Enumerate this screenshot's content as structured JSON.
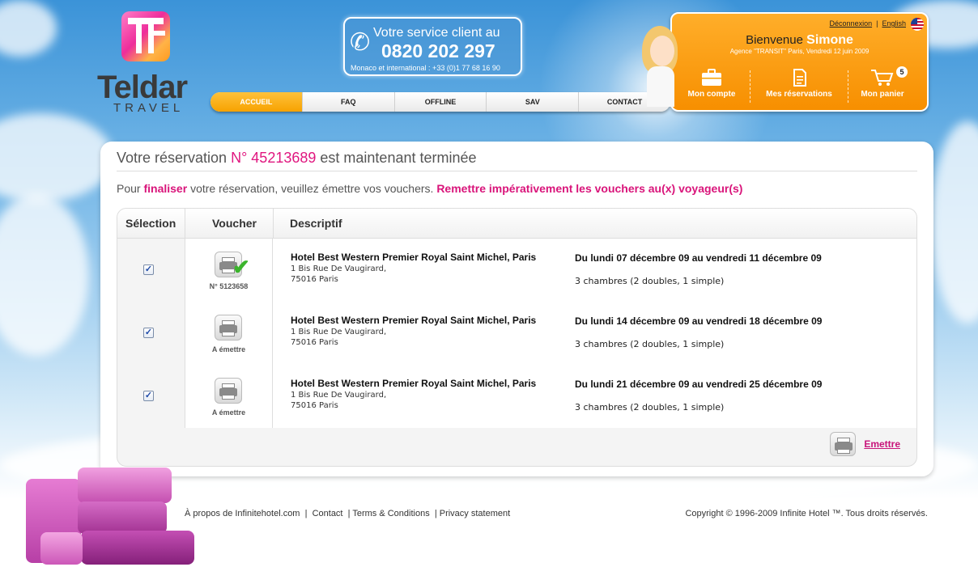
{
  "brand": {
    "name": "Teldar",
    "sub": "TRAVEL"
  },
  "phone": {
    "line1": "Votre service client au",
    "number": "0820 202 297",
    "intl": "Monaco et international : +33 (0)1 77 68 16 90"
  },
  "nav": {
    "items": [
      {
        "label": "ACCUEIL",
        "active": true
      },
      {
        "label": "FAQ"
      },
      {
        "label": "OFFLINE"
      },
      {
        "label": "SAV"
      },
      {
        "label": "CONTACT"
      }
    ]
  },
  "user": {
    "logout": "Déconnexion",
    "separator": "|",
    "language": "English",
    "welcome": "Bienvenue",
    "name": "Simone",
    "agency": "Agence \"TRANSIT\" Paris, Vendredi 12 juin 2009",
    "account": "Mon compte",
    "reservations": "Mes réservations",
    "cart": "Mon panier",
    "cart_count": "5"
  },
  "main": {
    "title_prefix": "Votre réservation",
    "title_number": "N° 45213689",
    "title_suffix": "est maintenant terminée",
    "intro_prefix": "Pour",
    "intro_bold": "finaliser",
    "intro_middle": "votre réservation, veuillez émettre vos vouchers.",
    "intro_warning": "Remettre impérativement les vouchers au(x) voyageur(s)",
    "columns": {
      "selection": "Sélection",
      "voucher": "Voucher",
      "description": "Descriptif"
    },
    "rows": [
      {
        "checked": "✓",
        "voucher_label": "N° 5123658",
        "hotel": "Hotel Best Western Premier Royal Saint Michel, Paris",
        "address1": "1 Bis Rue De Vaugirard,",
        "address2": "75016 Paris",
        "dates": "Du lundi 07 décembre 09 au vendredi 11 décembre 09",
        "rooms": "3 chambres (2 doubles, 1 simple)"
      },
      {
        "checked": "✓",
        "voucher_label": "A émettre",
        "hotel": "Hotel Best Western Premier Royal Saint Michel, Paris",
        "address1": "1 Bis Rue De Vaugirard,",
        "address2": "75016 Paris",
        "dates": "Du lundi 14 décembre 09 au vendredi 18 décembre 09",
        "rooms": "3 chambres (2 doubles, 1 simple)"
      },
      {
        "checked": "✓",
        "voucher_label": "A émettre",
        "hotel": "Hotel Best Western Premier Royal Saint Michel, Paris",
        "address1": "1 Bis Rue De Vaugirard,",
        "address2": "75016 Paris",
        "dates": "Du lundi 21 décembre 09 au vendredi 25 décembre 09",
        "rooms": "3 chambres (2 doubles, 1 simple)"
      }
    ],
    "emit_label": "Emettre"
  },
  "footer": {
    "about": "À propos de Infinitehotel.com",
    "contact": "Contact",
    "terms": "Terms & Conditions",
    "privacy": "Privacy statement",
    "copyright": "Copyright © 1996-2009 Infinite Hotel ™. Tous droits réservés."
  },
  "colors": {
    "accent_pink": "#e0167f",
    "orange": "#f78f00",
    "sky": "#3b93d8"
  }
}
